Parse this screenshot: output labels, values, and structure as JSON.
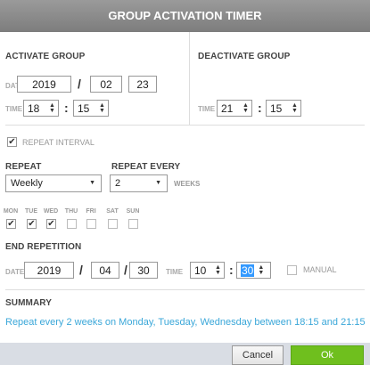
{
  "title": "GROUP ACTIVATION TIMER",
  "activate": {
    "heading": "ACTIVATE GROUP",
    "date_label": "DATE",
    "year": "2019",
    "month": "02",
    "day": "23",
    "time_label": "TIME",
    "hour": "18",
    "minute": "15"
  },
  "deactivate": {
    "heading": "DEACTIVATE GROUP",
    "time_label": "TIME",
    "hour": "21",
    "minute": "15"
  },
  "date_sep": "/",
  "time_sep": ":",
  "repeat_interval": {
    "label": "REPEAT INTERVAL",
    "checked": true
  },
  "repeat": {
    "label": "REPEAT",
    "value": "Weekly"
  },
  "repeat_every": {
    "label": "REPEAT EVERY",
    "value": "2",
    "unit": "WEEKS"
  },
  "days": [
    {
      "label": "MON",
      "checked": true
    },
    {
      "label": "TUE",
      "checked": true
    },
    {
      "label": "WED",
      "checked": true
    },
    {
      "label": "THU",
      "checked": false
    },
    {
      "label": "FRI",
      "checked": false
    },
    {
      "label": "SAT",
      "checked": false
    },
    {
      "label": "SUN",
      "checked": false
    }
  ],
  "end_repetition": {
    "heading": "END REPETITION",
    "date_label": "DATE",
    "year": "2019",
    "month": "04",
    "day": "30",
    "time_label": "TIME",
    "hour": "10",
    "minute": "30",
    "manual_label": "MANUAL",
    "manual_checked": false
  },
  "summary": {
    "heading": "SUMMARY",
    "text": "Repeat every 2 weeks on Monday, Tuesday, Wednesday between 18:15 and 21:15"
  },
  "buttons": {
    "cancel": "Cancel",
    "ok": "Ok"
  },
  "colors": {
    "summary_text": "#3aa7d9",
    "ok_button": "#6fbf1e",
    "selection": "#3399ff"
  },
  "icons": {
    "checkbox_mark": "check-icon",
    "spinner": "spinner-arrows-icon",
    "dropdown": "caret-down-icon"
  }
}
